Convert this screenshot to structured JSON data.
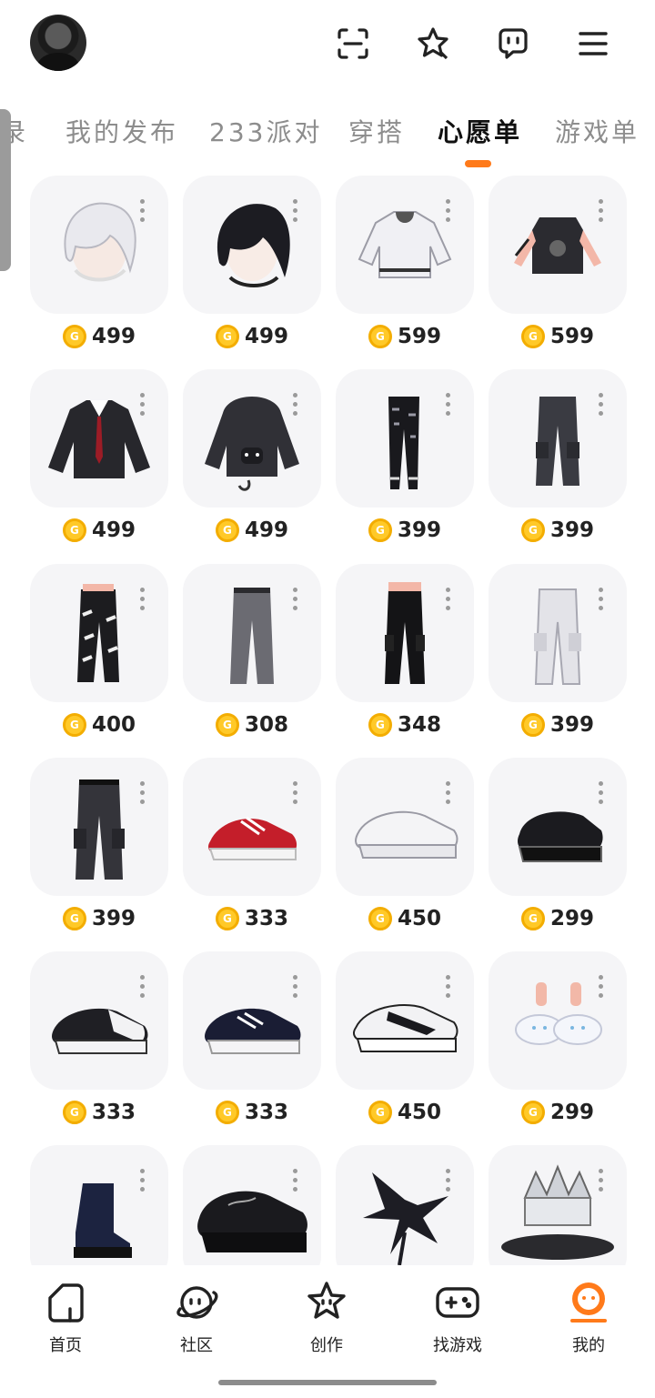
{
  "header": {
    "icons": [
      "scan-icon",
      "star-icon",
      "chat-icon",
      "menu-icon"
    ]
  },
  "tabs": [
    {
      "label": "录",
      "active": false
    },
    {
      "label": "我的发布",
      "active": false
    },
    {
      "label": "233派对",
      "active": false
    },
    {
      "label": "穿搭",
      "active": false
    },
    {
      "label": "心愿单",
      "active": true
    },
    {
      "label": "游戏单",
      "active": false
    }
  ],
  "accent_color": "#ff7a1a",
  "coin_symbol": "G",
  "items": [
    {
      "kind": "hair-white",
      "price": "499"
    },
    {
      "kind": "hair-black",
      "price": "499"
    },
    {
      "kind": "jacket-white",
      "price": "599"
    },
    {
      "kind": "tanktop-black",
      "price": "599"
    },
    {
      "kind": "sweater-black-tie",
      "price": "499"
    },
    {
      "kind": "hoodie-cat",
      "price": "499"
    },
    {
      "kind": "pants-black-print",
      "price": "399"
    },
    {
      "kind": "pants-dark-cargo",
      "price": "399"
    },
    {
      "kind": "jeans-ripped",
      "price": "400"
    },
    {
      "kind": "pants-grey",
      "price": "308"
    },
    {
      "kind": "pants-black-cargo",
      "price": "348"
    },
    {
      "kind": "pants-white-cargo",
      "price": "399"
    },
    {
      "kind": "pants-charcoal-cargo",
      "price": "399"
    },
    {
      "kind": "sneaker-red",
      "price": "333"
    },
    {
      "kind": "sneaker-white",
      "price": "450"
    },
    {
      "kind": "boot-black-platform",
      "price": "299"
    },
    {
      "kind": "sneaker-black-white",
      "price": "333"
    },
    {
      "kind": "sneaker-navy",
      "price": "333"
    },
    {
      "kind": "sneaker-black-stripe",
      "price": "450"
    },
    {
      "kind": "slipper-bunny",
      "price": "299"
    },
    {
      "kind": "boot-navy",
      "price": ""
    },
    {
      "kind": "sneaker-chunky-black",
      "price": ""
    },
    {
      "kind": "dragon-black",
      "price": ""
    },
    {
      "kind": "crown-silver",
      "price": ""
    }
  ],
  "bottom_nav": [
    {
      "label": "首页",
      "icon": "home-icon",
      "active": false
    },
    {
      "label": "社区",
      "icon": "planet-icon",
      "active": false
    },
    {
      "label": "创作",
      "icon": "star-create-icon",
      "active": false
    },
    {
      "label": "找游戏",
      "icon": "gamepad-icon",
      "active": false
    },
    {
      "label": "我的",
      "icon": "profile-icon",
      "active": true
    }
  ]
}
